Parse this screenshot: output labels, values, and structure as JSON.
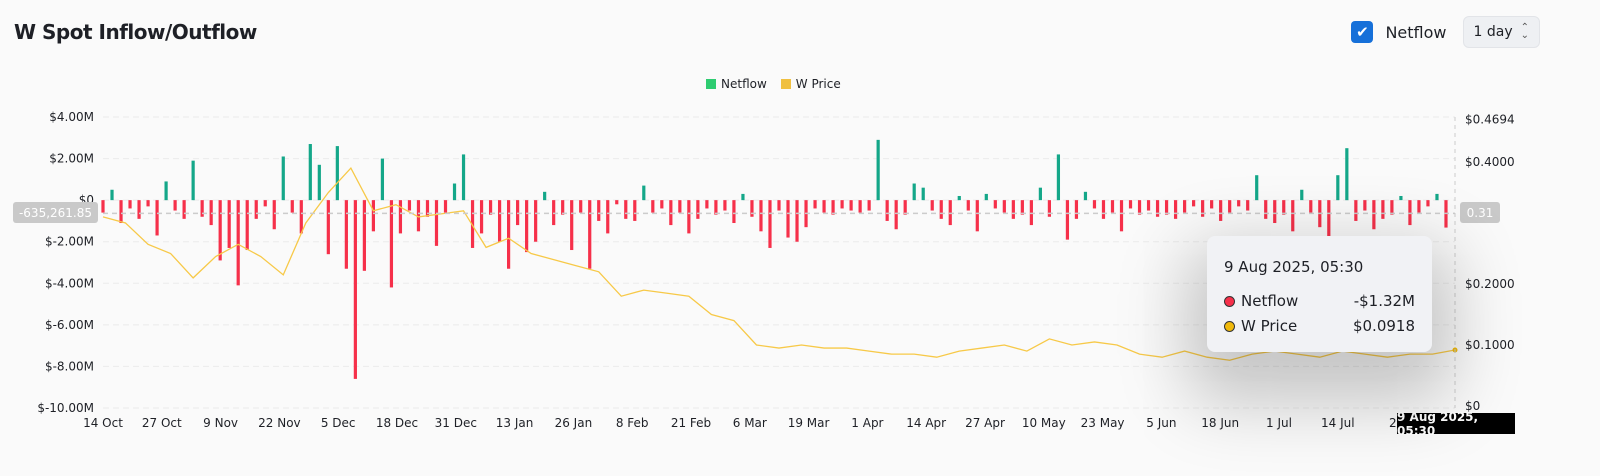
{
  "header": {
    "title": "W Spot Inflow/Outflow",
    "checkbox_label": "Netflow",
    "checkbox_checked": true,
    "interval": "1 day"
  },
  "colors": {
    "positive": "#14a789",
    "negative": "#f6304a",
    "price": "#f0b90b",
    "accent": "#1670d9"
  },
  "crosshair": {
    "left_value": "-635,261.85",
    "right_value": "0.31",
    "date": "9 Aug 2025, 05:30"
  },
  "tooltip": {
    "date": "9 Aug 2025, 05:30",
    "rows": [
      {
        "label": "Netflow",
        "value": "-$1.32M",
        "color": "#f6304a"
      },
      {
        "label": "W Price",
        "value": "$0.0918",
        "color": "#f0b90b"
      }
    ]
  },
  "chart_data": {
    "type": "bar+line",
    "title": "W Spot Inflow/Outflow",
    "legend": [
      "Netflow",
      "W Price"
    ],
    "legend_position": "top-center",
    "x_ticks": [
      "14 Oct",
      "27 Oct",
      "9 Nov",
      "22 Nov",
      "5 Dec",
      "18 Dec",
      "31 Dec",
      "13 Jan",
      "26 Jan",
      "8 Feb",
      "21 Feb",
      "6 Mar",
      "19 Mar",
      "1 Apr",
      "14 Apr",
      "27 Apr",
      "10 May",
      "23 May",
      "5 Jun",
      "18 Jun",
      "1 Jul",
      "14 Jul",
      "27"
    ],
    "y_left": {
      "label": "Netflow",
      "ticks": [
        "$4.00M",
        "$2.00M",
        "$0",
        "$-2.00M",
        "$-4.00M",
        "$-6.00M",
        "$-8.00M",
        "$-10.00M"
      ],
      "range": [
        -10,
        4
      ],
      "unit": "$M"
    },
    "y_right": {
      "label": "W Price",
      "ticks": [
        "$0.4694",
        "$0.4000",
        "$0.2000",
        "$0.1000",
        "$0"
      ],
      "range": [
        0,
        0.4694
      ]
    },
    "x_range_days": 300,
    "netflow_step_days": 2,
    "netflow": [
      -0.6,
      0.5,
      -1.1,
      -0.4,
      -0.9,
      -0.3,
      -1.7,
      0.9,
      -0.5,
      -0.9,
      1.9,
      -0.8,
      -1.2,
      -2.9,
      -2.3,
      -4.1,
      -2.4,
      -0.9,
      -0.3,
      -1.4,
      2.1,
      -0.6,
      -1.6,
      2.7,
      1.7,
      -2.6,
      2.6,
      -3.3,
      -8.6,
      -3.4,
      -1.5,
      2.0,
      -4.2,
      -1.6,
      -0.5,
      -1.5,
      -0.8,
      -2.2,
      -0.6,
      0.8,
      2.2,
      -2.3,
      -1.6,
      -0.7,
      -2.0,
      -3.3,
      -1.2,
      -2.5,
      -2.0,
      0.4,
      -1.2,
      -0.7,
      -2.4,
      -0.6,
      -3.3,
      -1.0,
      -1.6,
      -0.2,
      -0.9,
      -1.0,
      0.7,
      -0.6,
      -0.4,
      -1.2,
      -0.6,
      -1.6,
      -0.9,
      -0.4,
      -0.7,
      -0.5,
      -1.1,
      0.3,
      -0.8,
      -1.5,
      -2.3,
      -0.5,
      -1.8,
      -2.0,
      -1.3,
      -0.4,
      -0.6,
      -0.7,
      -0.4,
      -0.5,
      -0.6,
      -0.5,
      2.9,
      -1.0,
      -1.4,
      -0.7,
      0.8,
      0.6,
      -0.5,
      -0.9,
      -1.2,
      0.2,
      -0.5,
      -1.5,
      0.3,
      -0.4,
      -0.6,
      -0.9,
      -0.7,
      -1.2,
      0.6,
      -0.8,
      2.2,
      -1.9,
      -0.9,
      0.4,
      -0.4,
      -0.9,
      -0.6,
      -1.5,
      -0.4,
      -0.7,
      -0.5,
      -0.8,
      -0.7,
      -0.9,
      -0.6,
      -0.3,
      -0.8,
      -0.4,
      -1.0,
      -0.6,
      -0.3,
      -0.5,
      1.2,
      -0.9,
      -1.1,
      -0.7,
      -1.5,
      0.5,
      -0.6,
      -1.3,
      -2.0,
      1.2,
      2.5,
      -1.0,
      -0.5,
      -1.4,
      -0.9,
      -0.7,
      0.2,
      -1.2,
      -0.6,
      -0.3,
      0.3,
      -1.32
    ],
    "price_step_days": 5,
    "price": [
      0.31,
      0.3,
      0.265,
      0.25,
      0.21,
      0.245,
      0.265,
      0.245,
      0.215,
      0.3,
      0.35,
      0.39,
      0.32,
      0.33,
      0.31,
      0.315,
      0.32,
      0.26,
      0.275,
      0.25,
      0.24,
      0.23,
      0.22,
      0.18,
      0.19,
      0.185,
      0.18,
      0.15,
      0.14,
      0.1,
      0.095,
      0.1,
      0.095,
      0.095,
      0.09,
      0.085,
      0.085,
      0.08,
      0.09,
      0.095,
      0.1,
      0.09,
      0.11,
      0.1,
      0.105,
      0.1,
      0.085,
      0.08,
      0.09,
      0.08,
      0.075,
      0.085,
      0.09,
      0.085,
      0.08,
      0.09,
      0.085,
      0.08,
      0.085,
      0.085,
      0.0918
    ]
  }
}
